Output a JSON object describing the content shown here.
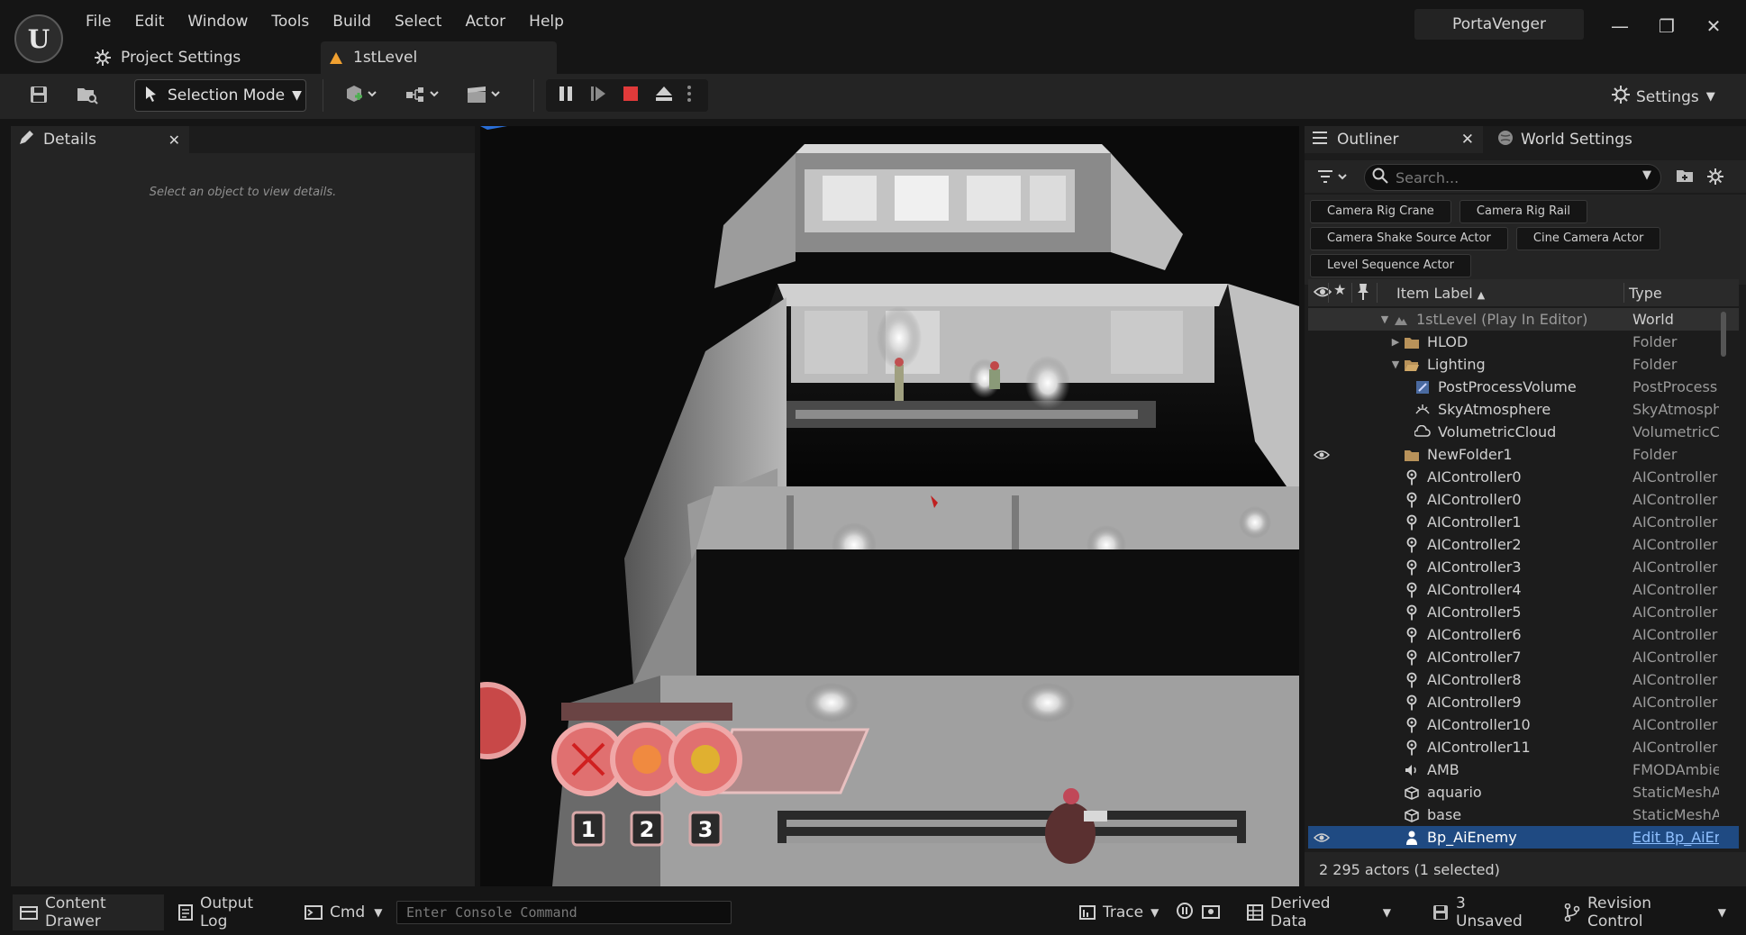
{
  "app": {
    "logo_letter": "U",
    "project_name": "PortaVenger",
    "menu": [
      "File",
      "Edit",
      "Window",
      "Tools",
      "Build",
      "Select",
      "Actor",
      "Help"
    ],
    "tabs": {
      "project_settings": "Project Settings",
      "level": "1stLevel"
    },
    "window_controls": {
      "minimize": "—",
      "restore": "❐",
      "close": "✕"
    }
  },
  "toolbar": {
    "selection_mode": "Selection Mode",
    "settings": "Settings"
  },
  "details": {
    "title": "Details",
    "empty_message": "Select an object to view details."
  },
  "viewport": {
    "hud_slots": [
      "1",
      "2",
      "3"
    ]
  },
  "outliner": {
    "tab_outliner": "Outliner",
    "tab_world_settings": "World Settings",
    "search_placeholder": "Search...",
    "chips": [
      "Camera Rig Crane",
      "Camera Rig Rail",
      "Camera Shake Source Actor",
      "Cine Camera Actor",
      "Level Sequence Actor"
    ],
    "columns": {
      "label": "Item Label",
      "type": "Type",
      "sort_arrow": "▲"
    },
    "rows": [
      {
        "label": "1stLevel (Play In Editor)",
        "type": "World",
        "depth": 0,
        "icon": "world-icon",
        "expand": "open"
      },
      {
        "label": "HLOD",
        "type": "Folder",
        "depth": 1,
        "icon": "folder-icon",
        "expand": "closed"
      },
      {
        "label": "Lighting",
        "type": "Folder",
        "depth": 1,
        "icon": "folder-open-icon",
        "expand": "open"
      },
      {
        "label": "PostProcessVolume",
        "type": "PostProcess",
        "depth": 2,
        "icon": "postprocess-icon"
      },
      {
        "label": "SkyAtmosphere",
        "type": "SkyAtmosph",
        "depth": 2,
        "icon": "sky-icon"
      },
      {
        "label": "VolumetricCloud",
        "type": "VolumetricC",
        "depth": 2,
        "icon": "cloud-icon"
      },
      {
        "label": "NewFolder1",
        "type": "Folder",
        "depth": 1,
        "icon": "folder-icon"
      },
      {
        "label": "AIController0",
        "type": "AIController",
        "depth": 1,
        "icon": "aicontroller-icon"
      },
      {
        "label": "AIController0",
        "type": "AIController",
        "depth": 1,
        "icon": "aicontroller-icon"
      },
      {
        "label": "AIController1",
        "type": "AIController",
        "depth": 1,
        "icon": "aicontroller-icon"
      },
      {
        "label": "AIController2",
        "type": "AIController",
        "depth": 1,
        "icon": "aicontroller-icon"
      },
      {
        "label": "AIController3",
        "type": "AIController",
        "depth": 1,
        "icon": "aicontroller-icon"
      },
      {
        "label": "AIController4",
        "type": "AIController",
        "depth": 1,
        "icon": "aicontroller-icon"
      },
      {
        "label": "AIController5",
        "type": "AIController",
        "depth": 1,
        "icon": "aicontroller-icon"
      },
      {
        "label": "AIController6",
        "type": "AIController",
        "depth": 1,
        "icon": "aicontroller-icon"
      },
      {
        "label": "AIController7",
        "type": "AIController",
        "depth": 1,
        "icon": "aicontroller-icon"
      },
      {
        "label": "AIController8",
        "type": "AIController",
        "depth": 1,
        "icon": "aicontroller-icon"
      },
      {
        "label": "AIController9",
        "type": "AIController",
        "depth": 1,
        "icon": "aicontroller-icon"
      },
      {
        "label": "AIController10",
        "type": "AIController",
        "depth": 1,
        "icon": "aicontroller-icon"
      },
      {
        "label": "AIController11",
        "type": "AIController",
        "depth": 1,
        "icon": "aicontroller-icon"
      },
      {
        "label": "AMB",
        "type": "FMODAmbie",
        "depth": 1,
        "icon": "sound-icon"
      },
      {
        "label": "aquario",
        "type": "StaticMeshA",
        "depth": 1,
        "icon": "staticmesh-icon"
      },
      {
        "label": "base",
        "type": "StaticMeshA",
        "depth": 1,
        "icon": "staticmesh-icon"
      },
      {
        "label": "Bp_AiEnemy",
        "type": "Edit Bp_AiEr",
        "depth": 1,
        "icon": "pawn-icon",
        "selected": true
      }
    ],
    "footer": "2 295 actors (1 selected)"
  },
  "statusbar": {
    "content_drawer": "Content Drawer",
    "output_log": "Output Log",
    "cmd": "Cmd",
    "console_placeholder": "Enter Console Command",
    "trace": "Trace",
    "derived_data": "Derived Data",
    "unsaved": "3 Unsaved",
    "revision_control": "Revision Control"
  },
  "colors": {
    "accent_selected": "#1f4a82",
    "stop_red": "#e03a3a",
    "add_green": "#4caf50",
    "level_tab_orange": "#f0a030"
  }
}
